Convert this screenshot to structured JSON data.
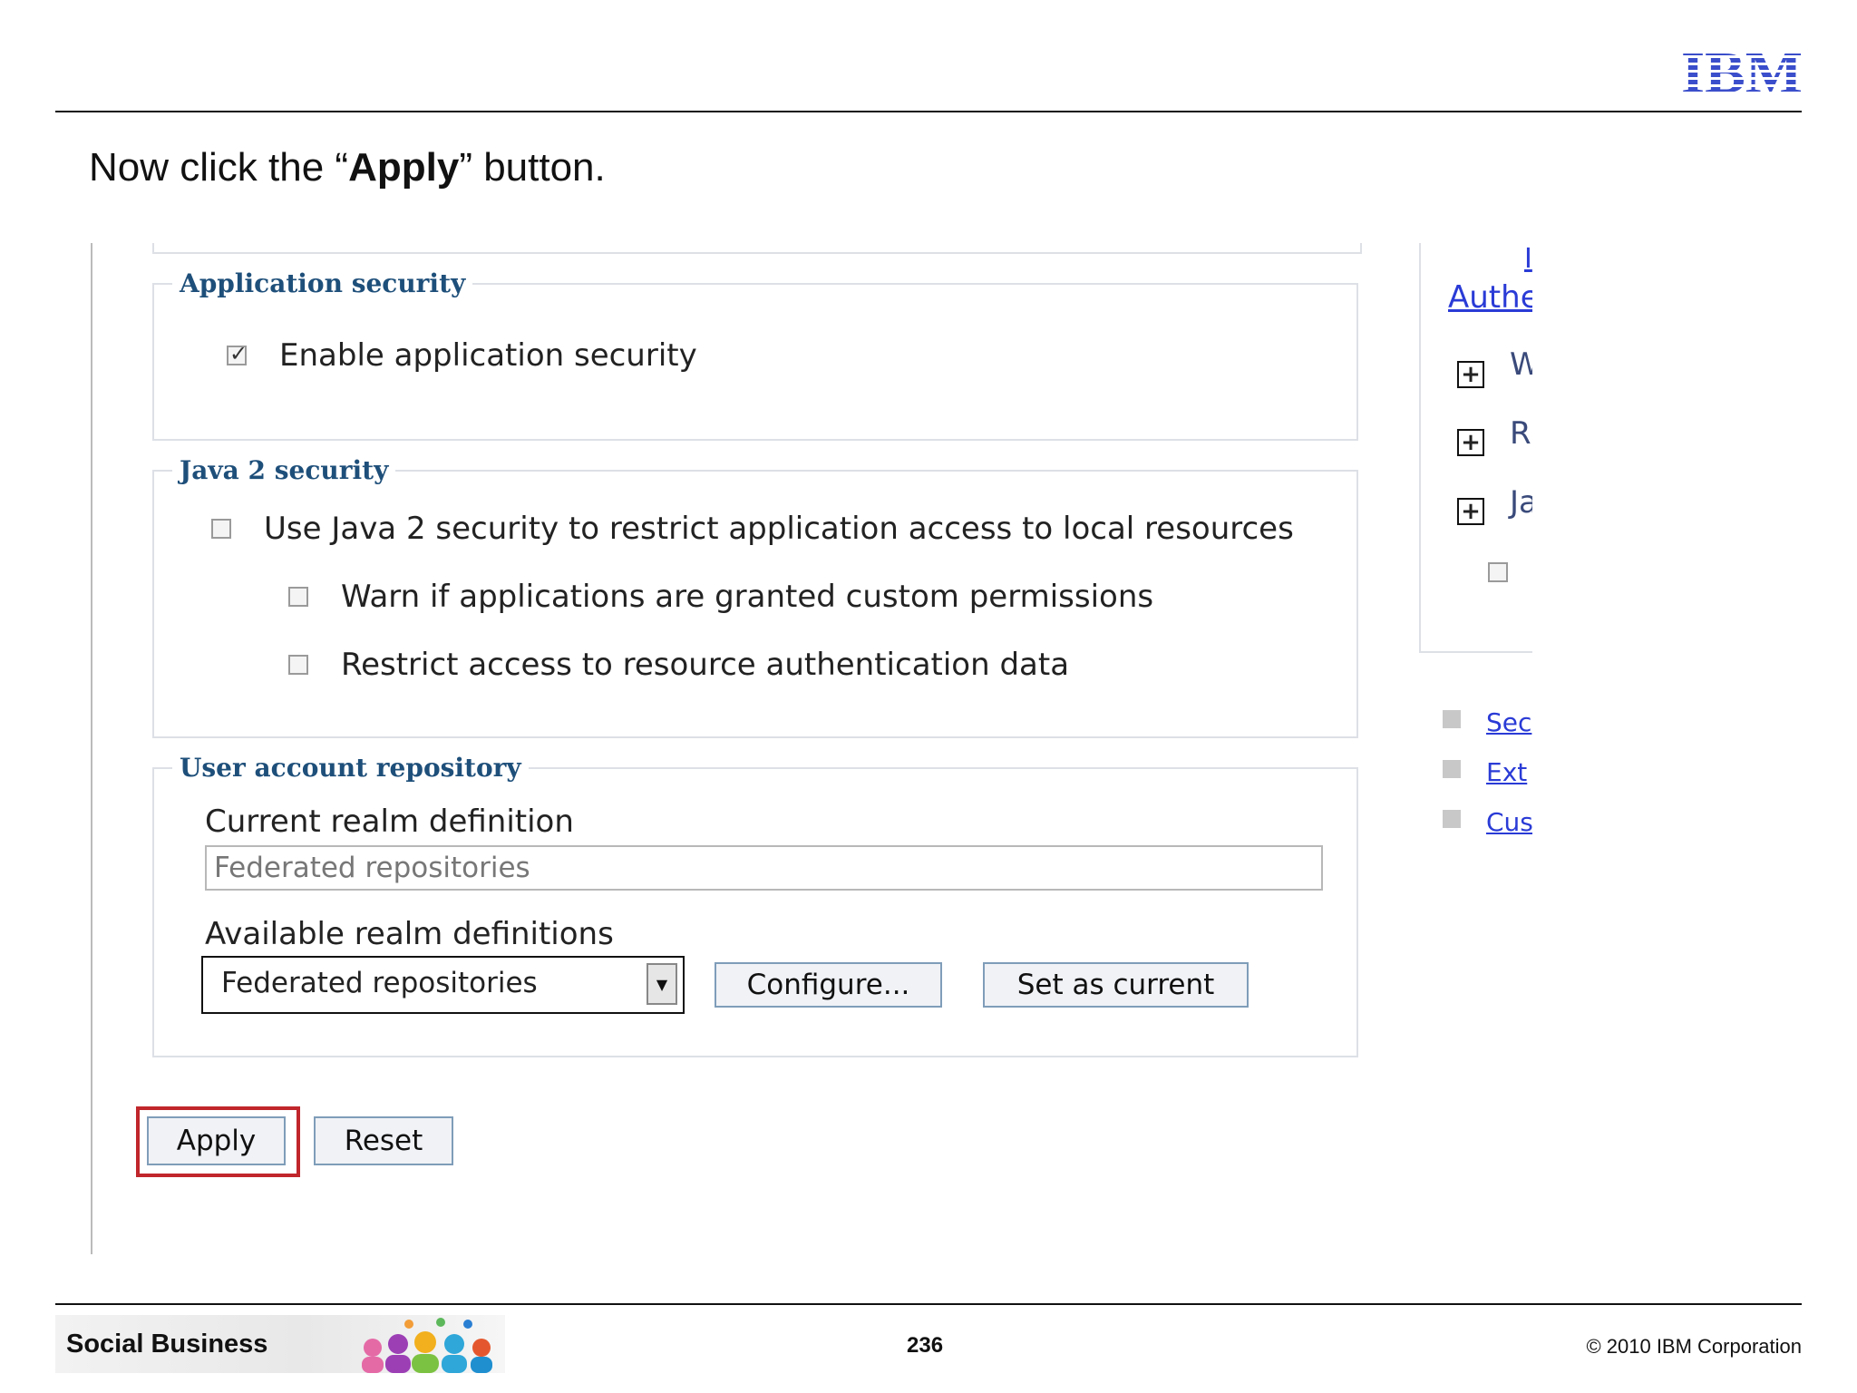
{
  "slide": {
    "logo_text": "IBM",
    "instruction": {
      "prefix": "Now click the “",
      "emphasis": "Apply",
      "suffix": "” button."
    },
    "footer": {
      "brand": "Social Business",
      "page_number": "236",
      "copyright": "© 2010 IBM Corporation"
    }
  },
  "application_security": {
    "legend": "Application security",
    "enable_label": "Enable application security",
    "enable_checked": true
  },
  "java2_security": {
    "legend": "Java 2 security",
    "use_label": "Use Java 2 security to restrict application access to local resources",
    "use_checked": false,
    "warn_label": "Warn if applications are granted custom permissions",
    "warn_checked": false,
    "restrict_label": "Restrict access to resource authentication data",
    "restrict_checked": false
  },
  "user_account_repository": {
    "legend": "User account repository",
    "current_label": "Current realm definition",
    "current_value": "Federated repositories",
    "available_label": "Available realm definitions",
    "available_selected": "Federated repositories",
    "configure_button": "Configure...",
    "set_current_button": "Set as current"
  },
  "actions": {
    "apply_button": "Apply",
    "reset_button": "Reset"
  },
  "right_panel": {
    "top_link": "I",
    "auth_link": "Authe",
    "items": [
      "W",
      "R",
      "Ja"
    ],
    "links": [
      "Sec",
      "Ext",
      "Cus"
    ]
  },
  "colors": {
    "legend": "#1e4f7a",
    "link": "#2a3bd6",
    "highlight": "#c0262b",
    "button_border": "#7f9db9"
  }
}
